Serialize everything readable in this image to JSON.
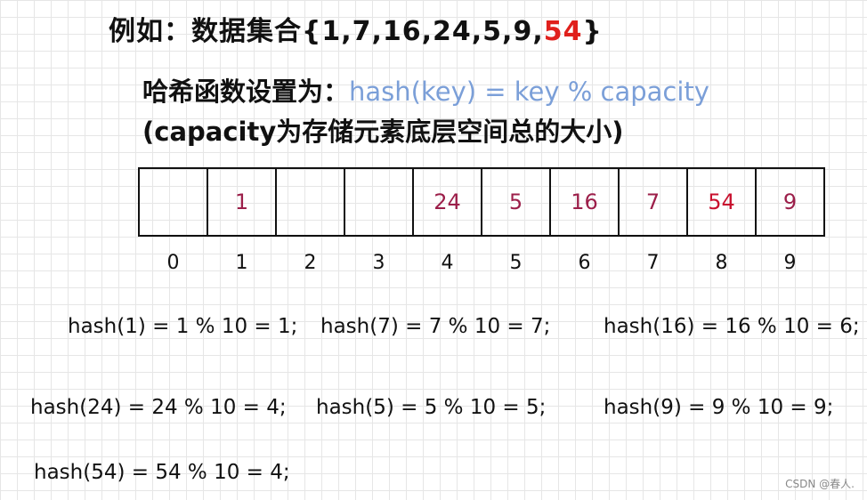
{
  "title": {
    "prefix": "例如：数据集合{1,7,16,24,5,9,",
    "highlight": "54",
    "suffix": "}",
    "highlight_color": "#e0201c"
  },
  "hash_func": {
    "label": "哈希函数设置为：",
    "formula": "hash(key) = key % capacity",
    "formula_color": "#7b9fd8"
  },
  "note": "(capacity为存储元素底层空间总的大小)",
  "array": {
    "cells": [
      "",
      "1",
      "",
      "",
      "24",
      "5",
      "16",
      "7",
      "54",
      "9"
    ],
    "indices": [
      "0",
      "1",
      "2",
      "3",
      "4",
      "5",
      "6",
      "7",
      "8",
      "9"
    ]
  },
  "equations": {
    "e1": "hash(1) = 1 % 10 = 1;",
    "e2": "hash(7) = 7 % 10 = 7;",
    "e3": "hash(16) = 16 % 10 = 6;",
    "e4": "hash(24) = 24 % 10 = 4;",
    "e5": "hash(5) = 5 % 10 = 5;",
    "e6": "hash(9) = 9 % 10 = 9;",
    "e7": "hash(54) = 54 % 10 = 4;"
  },
  "watermark": "CSDN @春人."
}
